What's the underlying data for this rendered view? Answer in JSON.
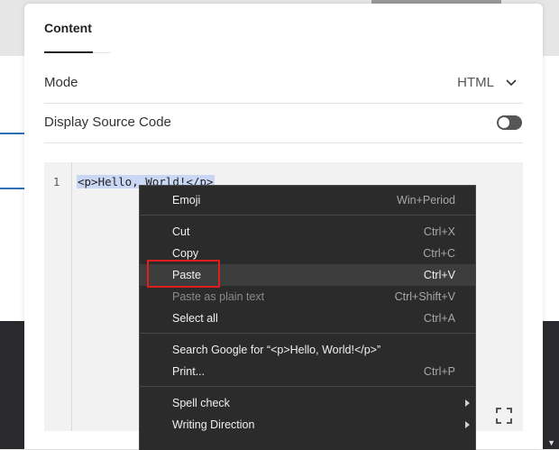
{
  "dialog": {
    "tab_label": "Content",
    "mode_label": "Mode",
    "mode_value": "HTML",
    "display_source_label": "Display Source Code",
    "display_source_enabled": false
  },
  "editor": {
    "line_number": "1",
    "code": "<p>Hello, World!</p>"
  },
  "context_menu": {
    "items": [
      {
        "label": "Emoji",
        "shortcut": "Win+Period"
      },
      {
        "label": "Cut",
        "shortcut": "Ctrl+X"
      },
      {
        "label": "Copy",
        "shortcut": "Ctrl+C"
      },
      {
        "label": "Paste",
        "shortcut": "Ctrl+V"
      },
      {
        "label": "Paste as plain text",
        "shortcut": "Ctrl+Shift+V"
      },
      {
        "label": "Select all",
        "shortcut": "Ctrl+A"
      },
      {
        "label": "Search Google for “<p>Hello, World!</p>”",
        "shortcut": ""
      },
      {
        "label": "Print...",
        "shortcut": "Ctrl+P"
      },
      {
        "label": "Spell check",
        "shortcut": ""
      },
      {
        "label": "Writing Direction",
        "shortcut": ""
      }
    ],
    "highlighted_item": "Paste",
    "highlight_color": "#e01e1e"
  },
  "icons": {
    "mode_dropdown": "chevron-down-icon",
    "fullscreen": "fullscreen-icon",
    "submenu": "chevron-right-icon"
  }
}
